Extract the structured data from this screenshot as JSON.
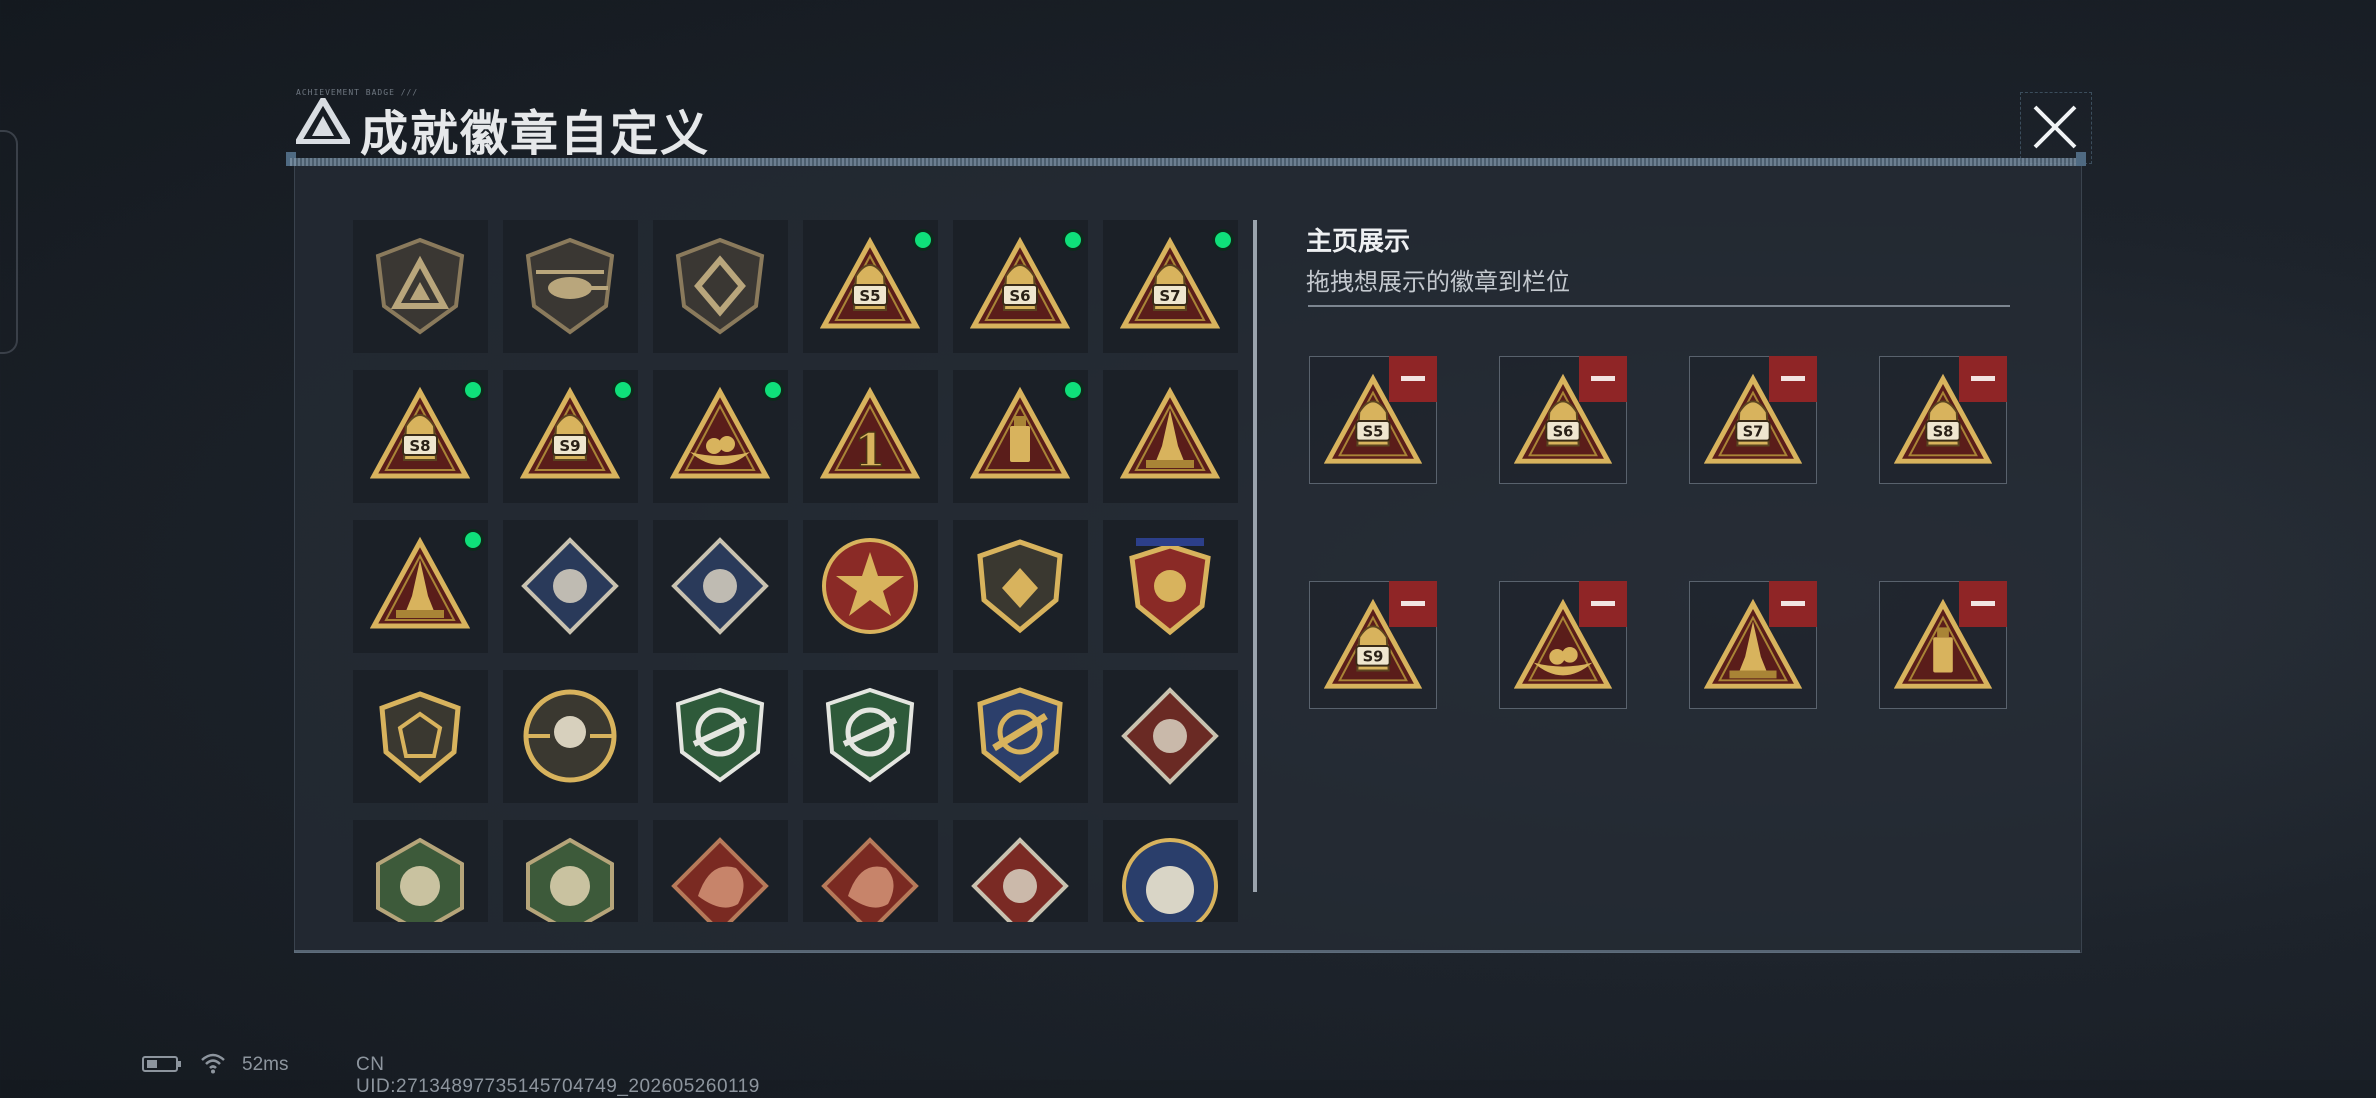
{
  "header": {
    "title": "成就徽章自定义",
    "micro_text": "ACHIEVEMENT BADGE ///",
    "logo_icon": "delta-triangle-logo-icon",
    "close_icon": "close-x-icon"
  },
  "colors": {
    "new_dot": "#0fe07a",
    "remove_button": "#8f2526",
    "gold": "#d8b35d",
    "dark_red": "#5a1d1a"
  },
  "badges": [
    {
      "name": "delta-logo-shield-badge",
      "new": false
    },
    {
      "name": "helicopter-shield-badge",
      "new": false
    },
    {
      "name": "emblem-shield-badge",
      "new": false
    },
    {
      "name": "s5-season-badge",
      "label": "S5",
      "new": true
    },
    {
      "name": "s6-season-badge",
      "label": "S6",
      "new": true
    },
    {
      "name": "s7-season-badge",
      "label": "S7",
      "new": true
    },
    {
      "name": "s8-season-badge",
      "label": "S8",
      "new": true
    },
    {
      "name": "s9-season-badge",
      "label": "S9",
      "new": true
    },
    {
      "name": "nest-triangle-badge",
      "new": true
    },
    {
      "name": "number-one-triangle-badge",
      "label": "1",
      "new": false
    },
    {
      "name": "usb-drive-triangle-badge",
      "new": true
    },
    {
      "name": "soldiers-triangle-badge",
      "new": false
    },
    {
      "name": "rocket-triangle-badge",
      "new": true
    },
    {
      "name": "rose-diamond-badge",
      "new": false
    },
    {
      "name": "launcher-diamond-badge",
      "new": false
    },
    {
      "name": "star-round-emblem-badge",
      "new": false
    },
    {
      "name": "gold-shield-badge",
      "new": false
    },
    {
      "name": "starred-crest-badge",
      "new": false
    },
    {
      "name": "dice-shield-badge",
      "new": false
    },
    {
      "name": "skull-target-badge",
      "new": false
    },
    {
      "name": "green-crosshair-rifle-badge",
      "new": false
    },
    {
      "name": "green-crosshair-smg-badge",
      "new": false
    },
    {
      "name": "blue-gold-wing-badge",
      "new": false
    },
    {
      "name": "wolf-diamond-badge",
      "new": false
    },
    {
      "name": "wasp-hexagon-badge",
      "new": false
    },
    {
      "name": "medic-hexagon-badge",
      "new": false
    },
    {
      "name": "red-dragon-badge",
      "new": false
    },
    {
      "name": "crimson-dragon-badge",
      "new": false
    },
    {
      "name": "runner-diamond-badge",
      "new": false
    },
    {
      "name": "blue-wolf-round-badge",
      "new": false
    }
  ],
  "showcase": {
    "title": "主页展示",
    "hint": "拖拽想展示的徽章到栏位",
    "slots": [
      {
        "badge": "s5-season-badge",
        "label": "S5"
      },
      {
        "badge": "s6-season-badge",
        "label": "S6"
      },
      {
        "badge": "s7-season-badge",
        "label": "S7"
      },
      {
        "badge": "s8-season-badge",
        "label": "S8"
      },
      {
        "badge": "s9-season-badge",
        "label": "S9"
      },
      {
        "badge": "nest-triangle-badge"
      },
      {
        "badge": "rocket-triangle-badge"
      },
      {
        "badge": "usb-drive-triangle-badge"
      }
    ],
    "remove_icon": "minus-icon"
  },
  "status_bar": {
    "ping": "52ms",
    "uid": "CN UID:27134897735145704749_202605260119",
    "battery_icon": "battery-icon",
    "wifi_icon": "wifi-icon"
  }
}
